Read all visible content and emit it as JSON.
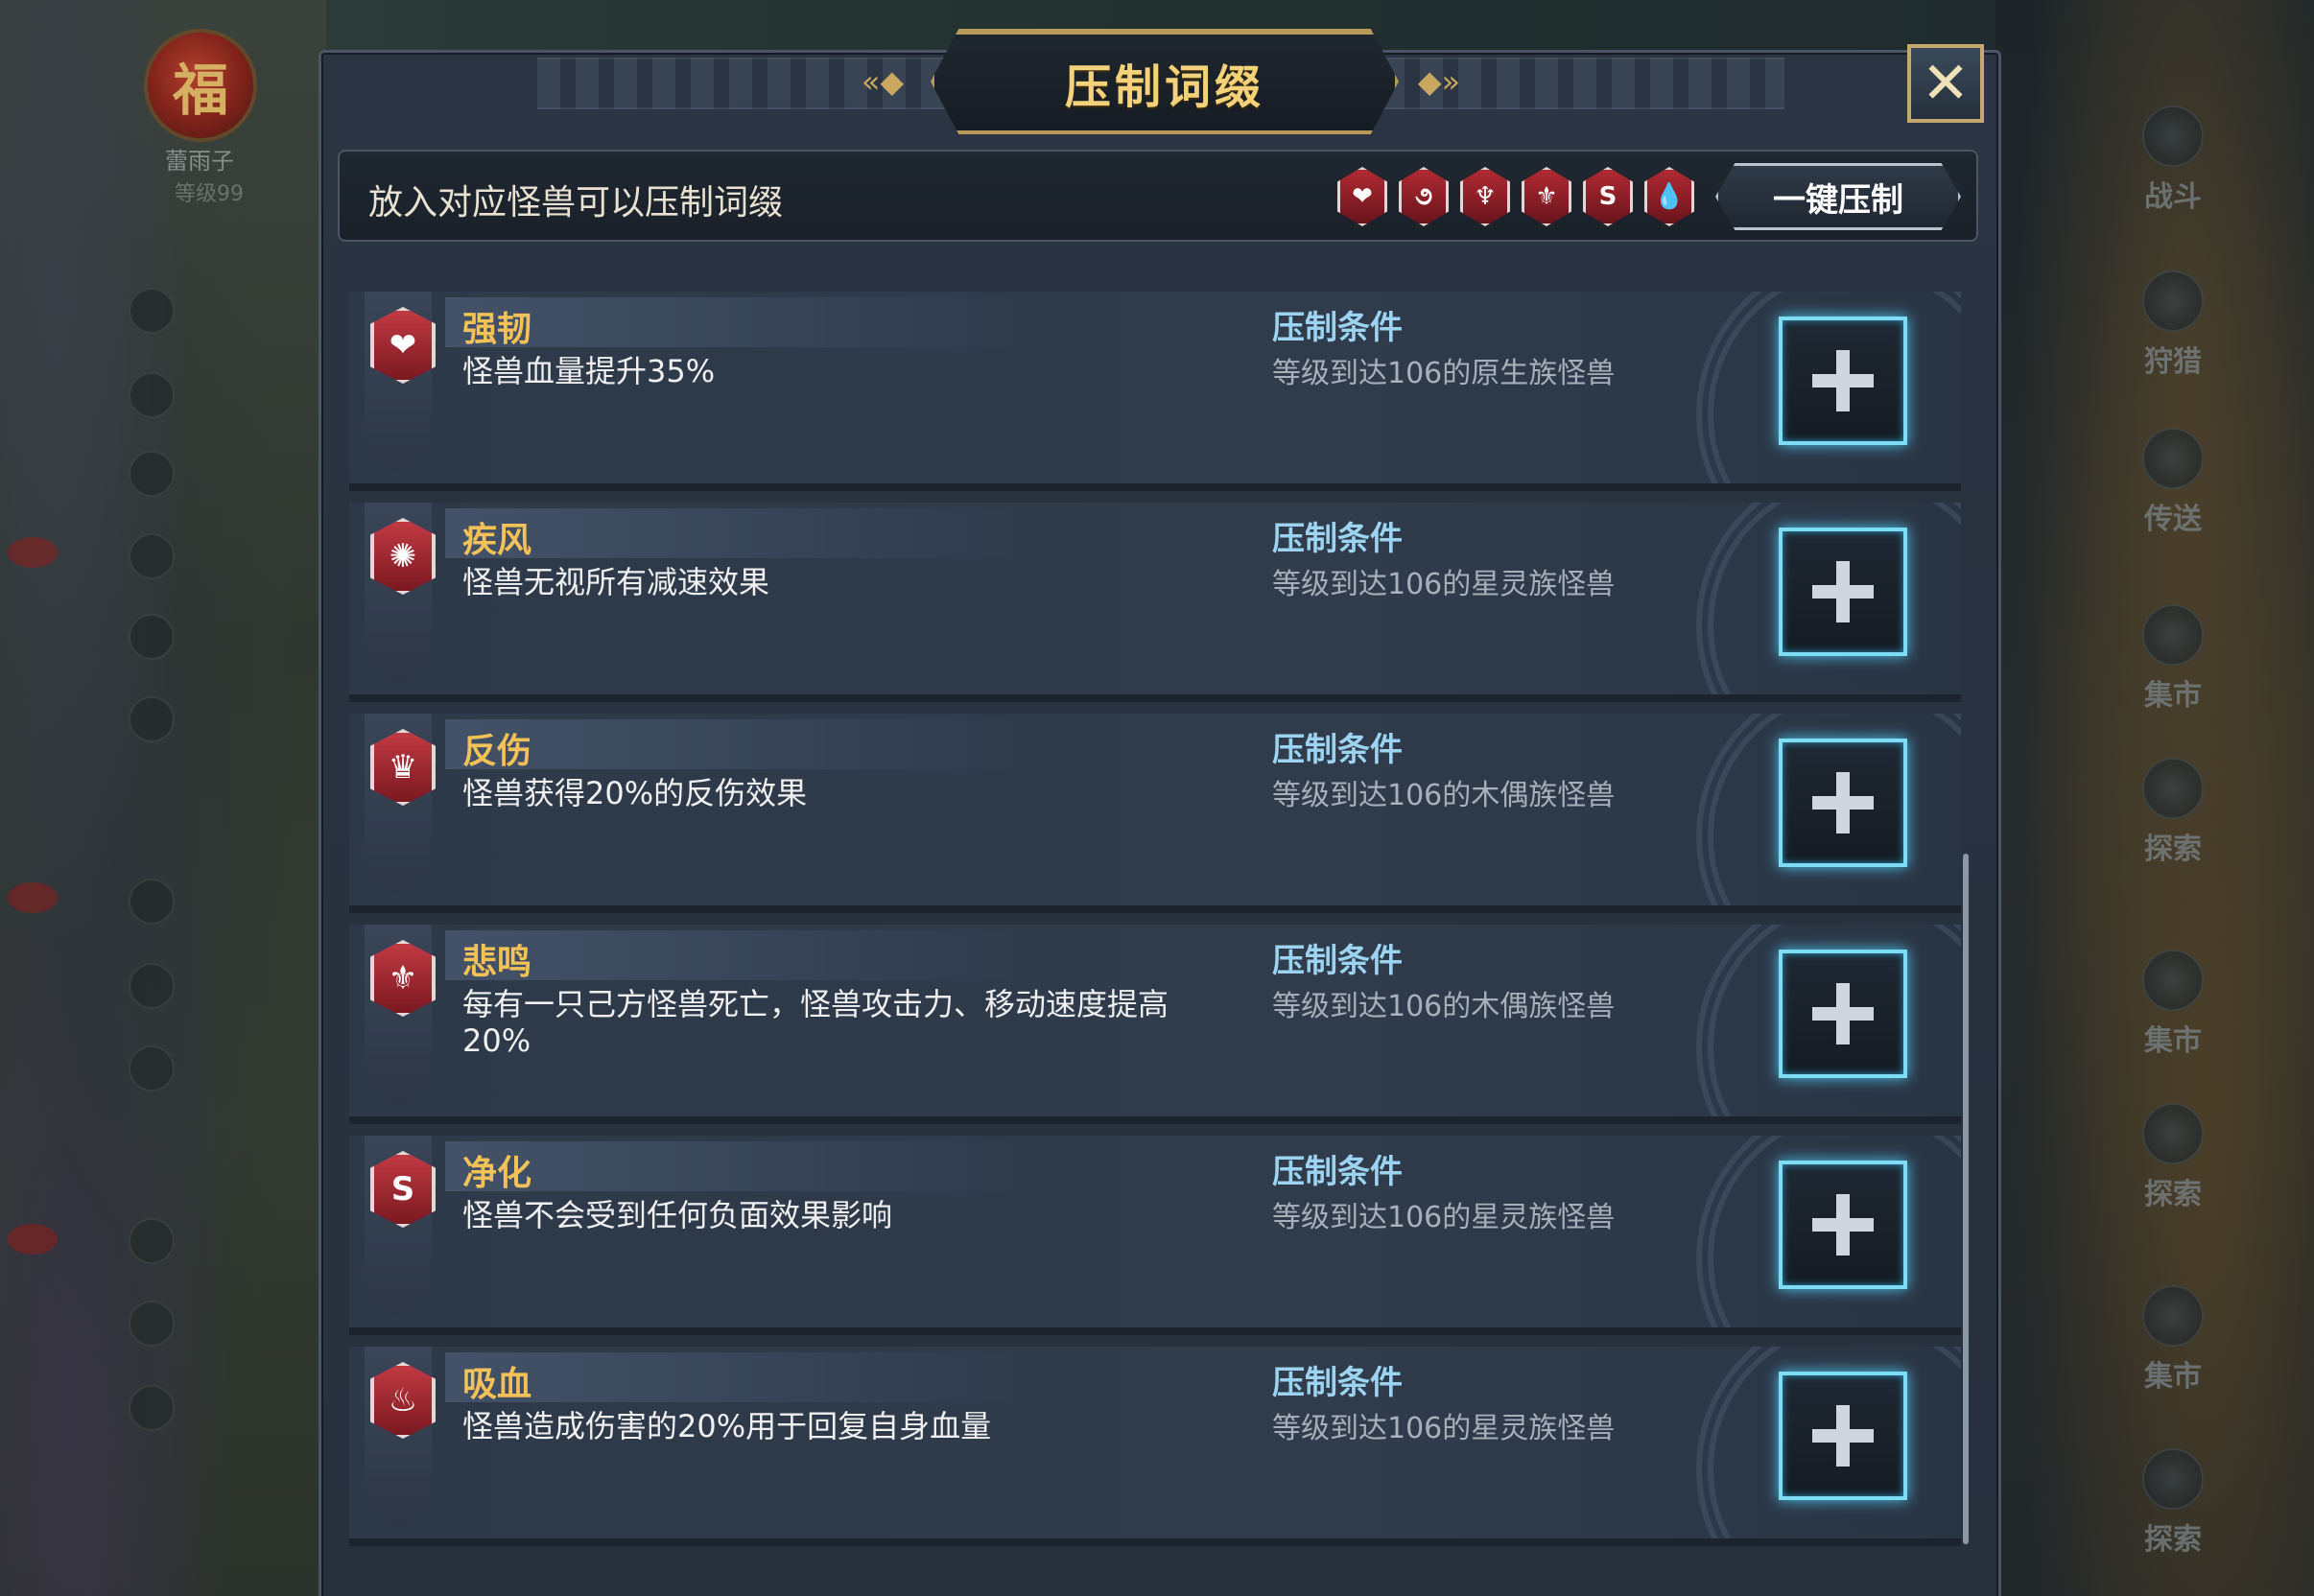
{
  "background": {
    "player_badge": "福",
    "player_name": "蕾雨子",
    "player_level": "等级99",
    "right_menu": [
      "战斗",
      "狩猎",
      "传送",
      "集市",
      "探索",
      "集市",
      "探索",
      "集市",
      "探索"
    ]
  },
  "dialog": {
    "title": "压制词缀",
    "close_glyph": "✕",
    "hint": "放入对应怪兽可以压制词缀",
    "one_key_label": "一键压制",
    "mini_icons": [
      "❤",
      "૭",
      "♆",
      "⚜",
      "S",
      "💧"
    ]
  },
  "affixes": [
    {
      "name": "强韧",
      "icon": "heart-icon",
      "glyph": "❤",
      "desc": "怪兽血量提升35%",
      "cond_title": "压制条件",
      "cond": "等级到达106的原生族怪兽"
    },
    {
      "name": "疾风",
      "icon": "swirl-icon",
      "glyph": "✺",
      "desc": "怪兽无视所有减速效果",
      "cond_title": "压制条件",
      "cond": "等级到达106的星灵族怪兽"
    },
    {
      "name": "反伤",
      "icon": "spike-crown-icon",
      "glyph": "♛",
      "desc": "怪兽获得20%的反伤效果",
      "cond_title": "压制条件",
      "cond": "等级到达106的木偶族怪兽"
    },
    {
      "name": "悲鸣",
      "icon": "wail-icon",
      "glyph": "⚜",
      "desc": "每有一只己方怪兽死亡，怪兽攻击力、移动速度提高20%",
      "cond_title": "压制条件",
      "cond": "等级到达106的木偶族怪兽"
    },
    {
      "name": "净化",
      "icon": "purify-icon",
      "glyph": "S",
      "desc": "怪兽不会受到任何负面效果影响",
      "cond_title": "压制条件",
      "cond": "等级到达106的星灵族怪兽"
    },
    {
      "name": "吸血",
      "icon": "blood-drop-icon",
      "glyph": "♨",
      "desc": "怪兽造成伤害的20%用于回复自身血量",
      "cond_title": "压制条件",
      "cond": "等级到达106的星灵族怪兽"
    }
  ]
}
